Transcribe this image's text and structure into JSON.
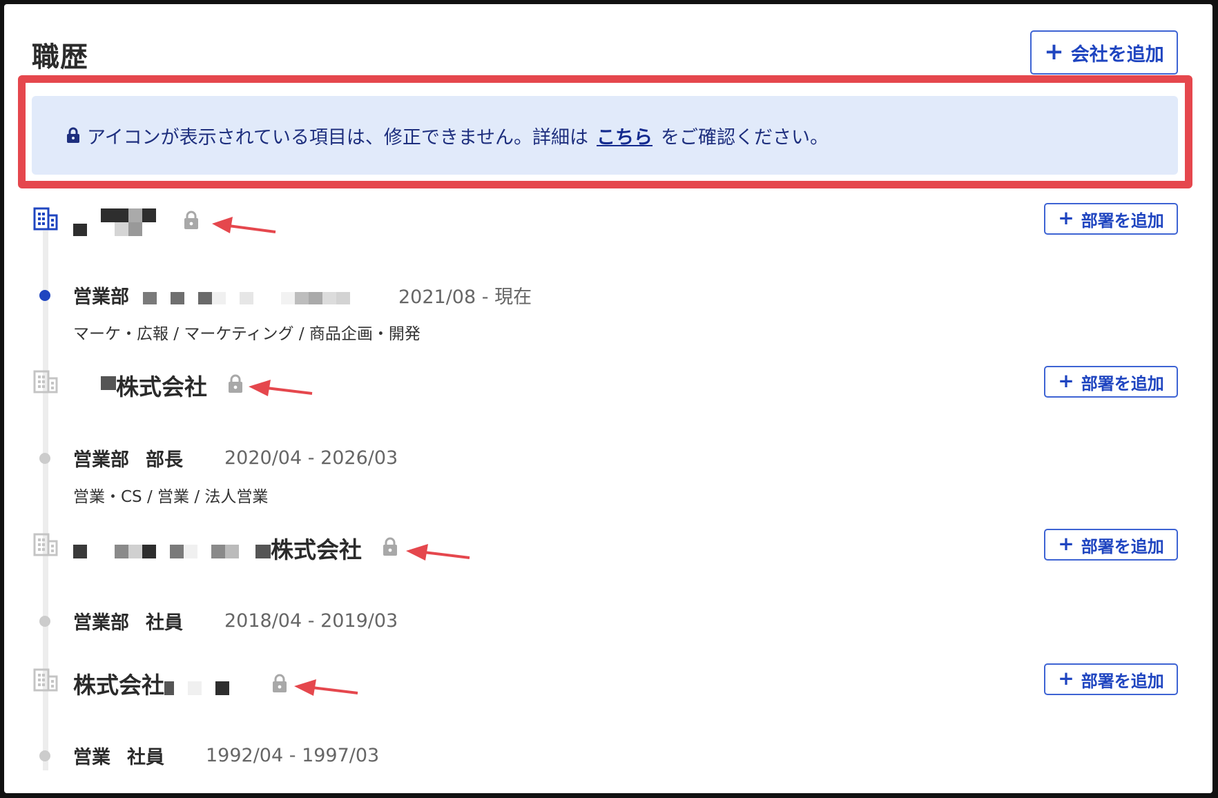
{
  "page": {
    "title": "職歴",
    "add_company_label": "会社を追加",
    "add_dept_label": "部署を追加",
    "plus_icon": "+"
  },
  "notice": {
    "text_before": "アイコンが表示されている項目は、修正できません。詳細は",
    "link_text": "こちら",
    "text_after": "をご確認ください。",
    "background_color": "#e1eafa",
    "highlight_color": "#e5474d"
  },
  "companies": [
    {
      "name_visible": "",
      "locked": true,
      "active": true,
      "positions": [
        {
          "dept": "営業部",
          "title": "",
          "period": "2021/08 - 現在",
          "job_category": "マーケ・広報 / マーケティング / 商品企画・開発"
        }
      ]
    },
    {
      "name_visible": "株式会社",
      "locked": true,
      "active": false,
      "positions": [
        {
          "dept": "営業部",
          "title": "部長",
          "period": "2020/04 - 2026/03",
          "job_category": "営業・CS / 営業 / 法人営業"
        }
      ]
    },
    {
      "name_visible": "株式会社",
      "locked": true,
      "active": false,
      "positions": [
        {
          "dept": "営業部",
          "title": "社員",
          "period": "2018/04 - 2019/03",
          "job_category": ""
        }
      ]
    },
    {
      "name_visible": "株式会社",
      "locked": true,
      "active": false,
      "positions": [
        {
          "dept": "営業",
          "title": "社員",
          "period": "1992/04 - 1997/03",
          "job_category": ""
        }
      ]
    }
  ],
  "icons": {
    "lock": "lock-icon",
    "company": "building-icon",
    "arrow": "red-arrow-annotation"
  },
  "colors": {
    "accent": "#1f45c0",
    "locked_gray": "#a8a8a8",
    "annotation_red": "#e5474d"
  }
}
